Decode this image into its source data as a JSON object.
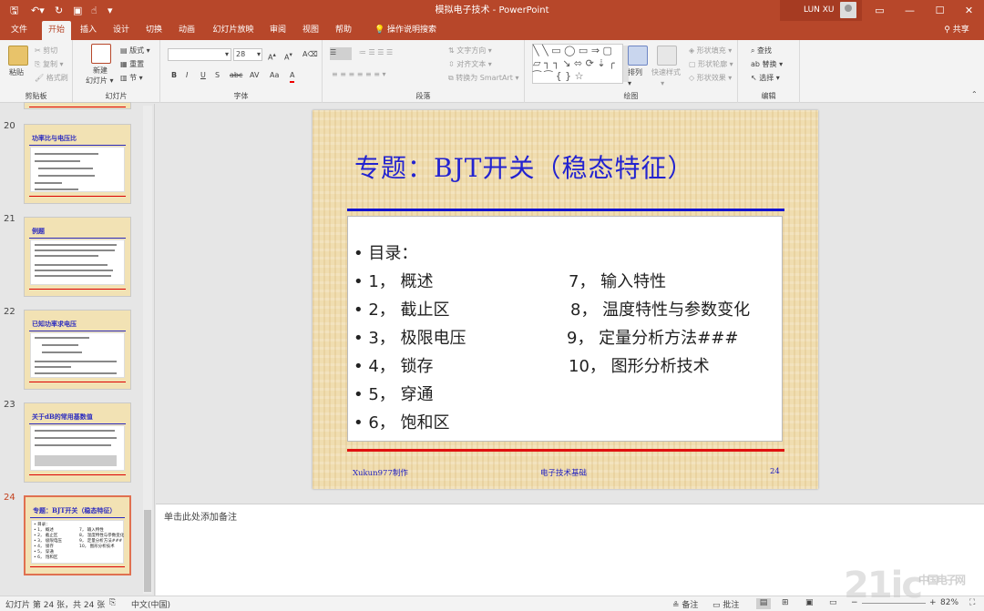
{
  "titlebar": {
    "title": "模拟电子技术  -  PowerPoint",
    "user": "LUN XU",
    "save_icon": "save-icon",
    "undo_icon": "undo-icon",
    "redo_icon": "redo-icon",
    "min": "—",
    "max": "☐",
    "close": "✕",
    "ribbon_display": "▭"
  },
  "menu": {
    "tabs": [
      "文件",
      "开始",
      "插入",
      "设计",
      "切换",
      "动画",
      "幻灯片放映",
      "审阅",
      "视图",
      "帮助"
    ],
    "active": "开始",
    "tell_me": "操作说明搜索",
    "share": "共享"
  },
  "ribbon": {
    "clipboard": {
      "label": "剪贴板",
      "paste": "粘贴",
      "cut": "剪切",
      "copy": "复制",
      "format_painter": "格式刷"
    },
    "slides": {
      "label": "幻灯片",
      "new_slide": "新建",
      "new_slide2": "幻灯片",
      "layout": "版式",
      "reset": "重置",
      "section": "节"
    },
    "font": {
      "label": "字体",
      "size": "28",
      "bold": "B",
      "italic": "I",
      "underline": "U",
      "strike": "S",
      "shadow": "abc",
      "spacing": "AV",
      "case": "Aa",
      "color": "A"
    },
    "paragraph": {
      "label": "段落",
      "text_direction": "文字方向",
      "align_text": "对齐文本",
      "smartart": "转换为 SmartArt"
    },
    "drawing": {
      "label": "绘图",
      "arrange": "排列",
      "quick_styles": "快速样式",
      "shape_fill": "形状填充",
      "shape_outline": "形状轮廓",
      "shape_effects": "形状效果"
    },
    "editing": {
      "label": "编辑",
      "find": "查找",
      "replace": "替换",
      "select": "选择"
    }
  },
  "thumbnails": [
    {
      "num": "20",
      "title": "功率比与电压比"
    },
    {
      "num": "21",
      "title": "例题"
    },
    {
      "num": "22",
      "title": "已知功率求电压"
    },
    {
      "num": "23",
      "title": "关于dB的常用基数值"
    },
    {
      "num": "24",
      "title": "专题：BJT开关（稳态特征）",
      "selected": true
    }
  ],
  "slide": {
    "title": "专题：BJT开关（稳态特征）",
    "heading": "• 目录：",
    "left_items": [
      "• 1，  概述",
      "• 2，  截止区",
      "• 3，  极限电压",
      "• 4，  锁存",
      "• 5，  穿通",
      "• 6，  饱和区"
    ],
    "right_items": [
      "7，  输入特性",
      "8，  温度特性与参数变化",
      "9，  定量分析方法###",
      "10，  图形分析技术"
    ],
    "footer_left": "Xukun977制作",
    "footer_center": "电子技术基础",
    "footer_right": "24"
  },
  "notes": {
    "placeholder": "单击此处添加备注"
  },
  "status": {
    "slide_info": "幻灯片 第 24 张，共 24 张",
    "language": "中文(中国)",
    "notes": "备注",
    "comments": "批注",
    "zoom": "82%"
  },
  "watermark": {
    "text": "21ic",
    "sub": "中国电子网"
  },
  "colors": {
    "accent": "#b7472a",
    "title_blue": "#2323d0",
    "red_rule": "#e01010"
  }
}
